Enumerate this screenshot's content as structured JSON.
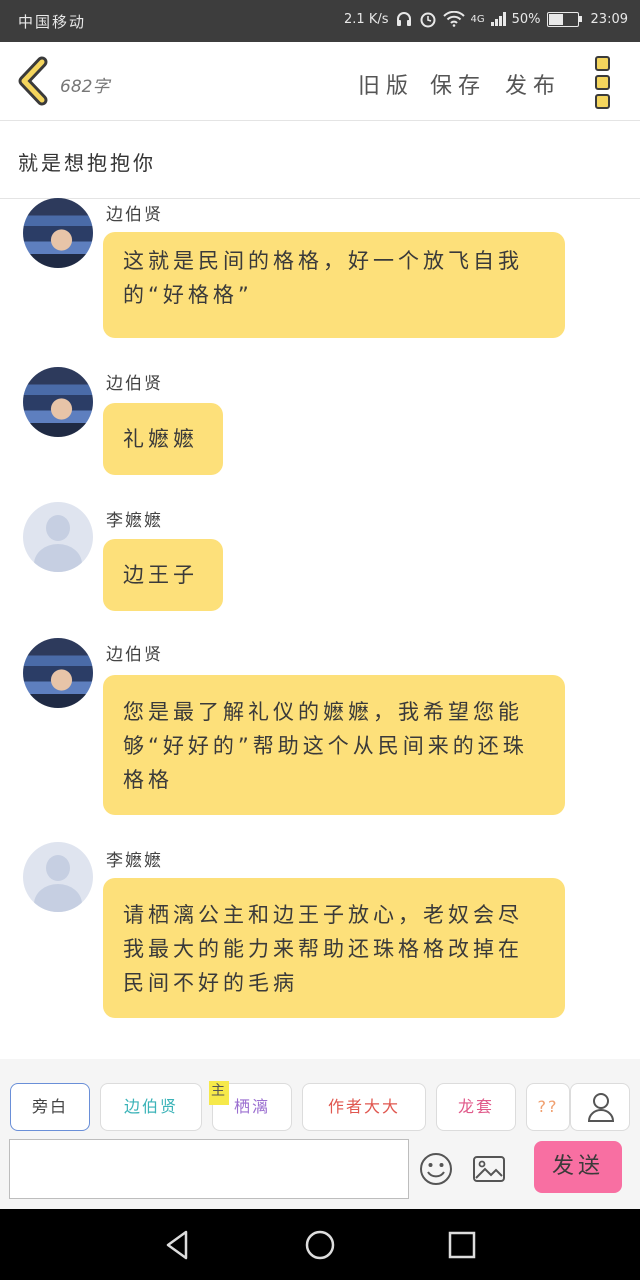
{
  "status": {
    "carrier": "中国移动",
    "speed": "2.1 K/s",
    "network": "4G",
    "battery": "50%",
    "time": "23:09"
  },
  "header": {
    "word_count": "682字",
    "old_version": "旧版",
    "save": "保存",
    "publish": "发布"
  },
  "title": "就是想抱抱你",
  "messages": [
    {
      "sender": "边伯贤",
      "avatar": "photo",
      "text": "这就是民间的格格，好一个放飞自我的“好格格”"
    },
    {
      "sender": "边伯贤",
      "avatar": "photo",
      "text": "礼嬷嬷"
    },
    {
      "sender": "李嬷嬷",
      "avatar": "default",
      "text": "边王子"
    },
    {
      "sender": "边伯贤",
      "avatar": "photo",
      "text": "您是最了解礼仪的嬷嬷，我希望您能够“好好的”帮助这个从民间来的还珠格格"
    },
    {
      "sender": "李嬷嬷",
      "avatar": "default",
      "text": "请栖漓公主和边王子放心，老奴会尽我最大的能力来帮助还珠格格改掉在民间不好的毛病"
    }
  ],
  "roles": [
    {
      "label": "旁白",
      "color": "#444444",
      "badge": ""
    },
    {
      "label": "边伯贤",
      "color": "#3bb3b8",
      "badge": ""
    },
    {
      "label": "栖漓",
      "color": "#9b6fd0",
      "badge": "主"
    },
    {
      "label": "作者大大",
      "color": "#e0574f",
      "badge": ""
    },
    {
      "label": "龙套",
      "color": "#e05a8a",
      "badge": ""
    },
    {
      "label": "??",
      "color": "#f0a070",
      "badge": ""
    }
  ],
  "send_label": "发送",
  "icons": [
    "back-chevron-icon",
    "menu-icon",
    "user-icon",
    "emoji-icon",
    "image-icon",
    "nav-back-icon",
    "nav-home-icon",
    "nav-recent-icon"
  ]
}
